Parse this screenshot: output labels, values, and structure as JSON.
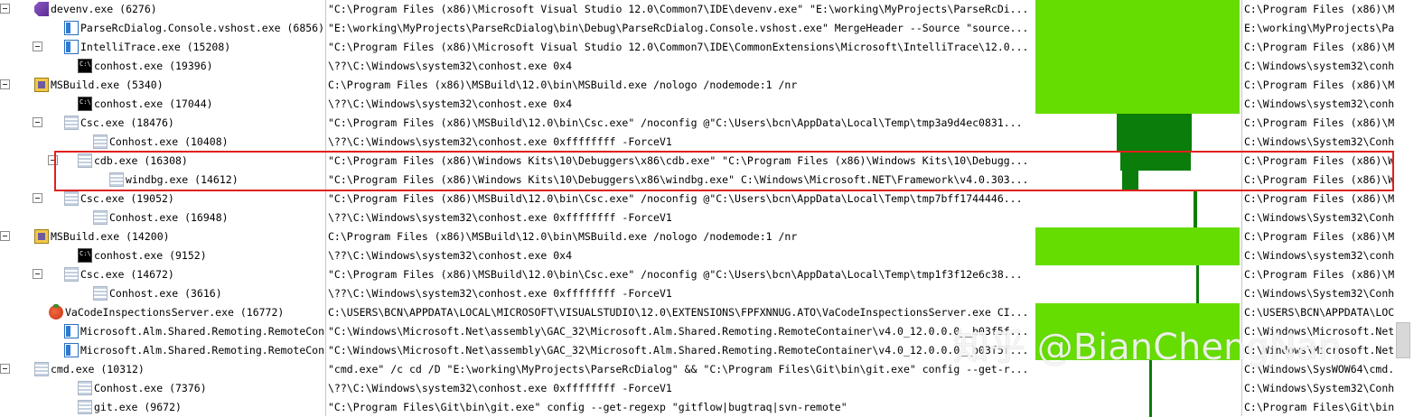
{
  "colors": {
    "bar_light": "#66dd00",
    "bar_dark": "#0a7d0a",
    "highlight": "#e02020",
    "separator": "#c8c8c8"
  },
  "processes": [
    {
      "name": "devenv.exe (6276)",
      "icon": "visual-studio-icon",
      "toggle": true,
      "cmd": "\"C:\\Program Files (x86)\\Microsoft Visual Studio 12.0\\Common7\\IDE\\devenv.exe\" \"E:\\working\\MyProjects\\ParseRcDi...",
      "path": "C:\\Program Files (x86)\\M"
    },
    {
      "name": "ParseRcDialog.Console.vshost.exe (6856)",
      "icon": "application-icon",
      "toggle": false,
      "cmd": "\"E:\\working\\MyProjects\\ParseRcDialog\\bin\\Debug\\ParseRcDialog.Console.vshost.exe\" MergeHeader --Source \"source...",
      "path": "E:\\working\\MyProjects\\Pa"
    },
    {
      "name": "IntelliTrace.exe (15208)",
      "icon": "application-icon",
      "toggle": true,
      "cmd": "\"C:\\Program Files (x86)\\Microsoft Visual Studio 12.0\\Common7\\IDE\\CommonExtensions\\Microsoft\\IntelliTrace\\12.0...",
      "path": "C:\\Program Files (x86)\\M"
    },
    {
      "name": "conhost.exe (19396)",
      "icon": "console-icon",
      "toggle": false,
      "cmd": "\\??\\C:\\Windows\\system32\\conhost.exe 0x4",
      "path": "C:\\Windows\\system32\\conh"
    },
    {
      "name": "MSBuild.exe (5340)",
      "icon": "msbuild-icon",
      "toggle": true,
      "cmd": "C:\\Program Files (x86)\\MSBuild\\12.0\\bin\\MSBuild.exe  /nologo /nodemode:1 /nr",
      "path": "C:\\Program Files (x86)\\M"
    },
    {
      "name": "conhost.exe (17044)",
      "icon": "console-icon",
      "toggle": false,
      "cmd": "\\??\\C:\\Windows\\system32\\conhost.exe 0x4",
      "path": "C:\\Windows\\system32\\conh"
    },
    {
      "name": "Csc.exe (18476)",
      "icon": "default-process-icon",
      "toggle": true,
      "cmd": "\"C:\\Program Files (x86)\\MSBuild\\12.0\\bin\\Csc.exe\"  /noconfig @\"C:\\Users\\bcn\\AppData\\Local\\Temp\\tmp3a9d4ec0831...",
      "path": "C:\\Program Files (x86)\\M"
    },
    {
      "name": "Conhost.exe (10408)",
      "icon": "default-process-icon",
      "toggle": false,
      "cmd": "\\??\\C:\\Windows\\system32\\conhost.exe 0xffffffff -ForceV1",
      "path": "C:\\Windows\\System32\\Conh"
    },
    {
      "name": "cdb.exe (16308)",
      "icon": "default-process-icon",
      "toggle": true,
      "cmd": "\"C:\\Program Files (x86)\\Windows Kits\\10\\Debuggers\\x86\\cdb.exe\" \"C:\\Program Files (x86)\\Windows Kits\\10\\Debugg...",
      "path": "C:\\Program Files (x86)\\W"
    },
    {
      "name": "windbg.exe (14612)",
      "icon": "default-process-icon",
      "toggle": false,
      "cmd": "\"C:\\Program Files (x86)\\Windows Kits\\10\\Debuggers\\x86\\windbg.exe\" C:\\Windows\\Microsoft.NET\\Framework\\v4.0.303...",
      "path": "C:\\Program Files (x86)\\W"
    },
    {
      "name": "Csc.exe (19052)",
      "icon": "default-process-icon",
      "toggle": true,
      "cmd": "\"C:\\Program Files (x86)\\MSBuild\\12.0\\bin\\Csc.exe\"  /noconfig @\"C:\\Users\\bcn\\AppData\\Local\\Temp\\tmp7bff1744446...",
      "path": "C:\\Program Files (x86)\\M"
    },
    {
      "name": "Conhost.exe (16948)",
      "icon": "default-process-icon",
      "toggle": false,
      "cmd": "\\??\\C:\\Windows\\system32\\conhost.exe 0xffffffff -ForceV1",
      "path": "C:\\Windows\\System32\\Conh"
    },
    {
      "name": "MSBuild.exe (14200)",
      "icon": "msbuild-icon",
      "toggle": true,
      "cmd": "C:\\Program Files (x86)\\MSBuild\\12.0\\bin\\MSBuild.exe  /nologo /nodemode:1 /nr",
      "path": "C:\\Program Files (x86)\\M"
    },
    {
      "name": "conhost.exe (9152)",
      "icon": "console-icon",
      "toggle": false,
      "cmd": "\\??\\C:\\Windows\\system32\\conhost.exe 0x4",
      "path": "C:\\Windows\\system32\\conh"
    },
    {
      "name": "Csc.exe (14672)",
      "icon": "default-process-icon",
      "toggle": true,
      "cmd": "\"C:\\Program Files (x86)\\MSBuild\\12.0\\bin\\Csc.exe\"  /noconfig @\"C:\\Users\\bcn\\AppData\\Local\\Temp\\tmp1f3f12e6c38...",
      "path": "C:\\Program Files (x86)\\M"
    },
    {
      "name": "Conhost.exe (3616)",
      "icon": "default-process-icon",
      "toggle": false,
      "cmd": "\\??\\C:\\Windows\\system32\\conhost.exe 0xffffffff -ForceV1",
      "path": "C:\\Windows\\System32\\Conh"
    },
    {
      "name": "VaCodeInspectionsServer.exe (16772)",
      "icon": "tomato-icon",
      "toggle": false,
      "cmd": "C:\\USERS\\BCN\\APPDATA\\LOCAL\\MICROSOFT\\VISUALSTUDIO\\12.0\\EXTENSIONS\\FPFXNNUG.ATO\\VaCodeInspectionsServer.exe CI...",
      "path": "C:\\USERS\\BCN\\APPDATA\\LOC"
    },
    {
      "name": "Microsoft.Alm.Shared.Remoting.RemoteConta",
      "icon": "application-icon",
      "toggle": false,
      "cmd": "\"C:\\Windows\\Microsoft.Net\\assembly\\GAC_32\\Microsoft.Alm.Shared.Remoting.RemoteContainer\\v4.0_12.0.0.0__b03f5f...",
      "path": "C:\\Windows\\Microsoft.Net"
    },
    {
      "name": "Microsoft.Alm.Shared.Remoting.RemoteConta",
      "icon": "application-icon",
      "toggle": false,
      "cmd": "\"C:\\Windows\\Microsoft.Net\\assembly\\GAC_32\\Microsoft.Alm.Shared.Remoting.RemoteContainer\\v4.0_12.0.0.0__b03f5f...",
      "path": "C:\\Windows\\Microsoft.Net"
    },
    {
      "name": "cmd.exe (10312)",
      "icon": "default-process-icon",
      "toggle": true,
      "cmd": "\"cmd.exe\" /c cd /D \"E:\\working\\MyProjects\\ParseRcDialog\" && \"C:\\Program Files\\Git\\bin\\git.exe\" config --get-r...",
      "path": "C:\\Windows\\SysWOW64\\cmd."
    },
    {
      "name": "Conhost.exe (7376)",
      "icon": "default-process-icon",
      "toggle": false,
      "cmd": "\\??\\C:\\Windows\\system32\\conhost.exe 0xffffffff -ForceV1",
      "path": "C:\\Windows\\System32\\Conh"
    },
    {
      "name": "git.exe (9672)",
      "icon": "default-process-icon",
      "toggle": false,
      "cmd": "\"C:\\Program Files\\Git\\bin\\git.exe\"  config --get-regexp \"gitflow|bugtraq|svn-remote\"",
      "path": "C:\\Program Files\\Git\\bin"
    }
  ],
  "timeline_bars": [
    {
      "start": 0.0,
      "end": 1.0,
      "tone": "bar_light"
    },
    {
      "start": 0.0,
      "end": 1.0,
      "tone": "bar_light"
    },
    {
      "start": 0.0,
      "end": 1.0,
      "tone": "bar_light"
    },
    {
      "start": 0.0,
      "end": 1.0,
      "tone": "bar_light"
    },
    {
      "start": 0.0,
      "end": 1.0,
      "tone": "bar_light"
    },
    {
      "start": 0.0,
      "end": 1.0,
      "tone": "bar_light"
    },
    {
      "start": 0.398,
      "end": 0.765,
      "tone": "bar_dark"
    },
    {
      "start": 0.398,
      "end": 0.765,
      "tone": "bar_dark"
    },
    {
      "start": 0.418,
      "end": 0.765,
      "tone": "bar_dark"
    },
    {
      "start": 0.425,
      "end": 0.504,
      "tone": "bar_dark"
    },
    {
      "start": 0.774,
      "end": 0.792,
      "tone": "bar_dark"
    },
    {
      "start": 0.774,
      "end": 0.792,
      "tone": "bar_dark"
    },
    {
      "start": 0.0,
      "end": 1.0,
      "tone": "bar_light"
    },
    {
      "start": 0.0,
      "end": 1.0,
      "tone": "bar_light"
    },
    {
      "start": 0.788,
      "end": 0.801,
      "tone": "bar_dark"
    },
    {
      "start": 0.788,
      "end": 0.801,
      "tone": "bar_dark"
    },
    {
      "start": 0.0,
      "end": 1.0,
      "tone": "bar_light"
    },
    {
      "start": 0.0,
      "end": 1.0,
      "tone": "bar_light"
    },
    {
      "start": 0.0,
      "end": 1.0,
      "tone": "bar_light"
    },
    {
      "start": 0.558,
      "end": 0.571,
      "tone": "bar_dark"
    },
    {
      "start": 0.558,
      "end": 0.571,
      "tone": "bar_dark"
    },
    {
      "start": 0.558,
      "end": 0.571,
      "tone": "bar_dark"
    }
  ],
  "watermark": "知乎 @BianChengNan"
}
